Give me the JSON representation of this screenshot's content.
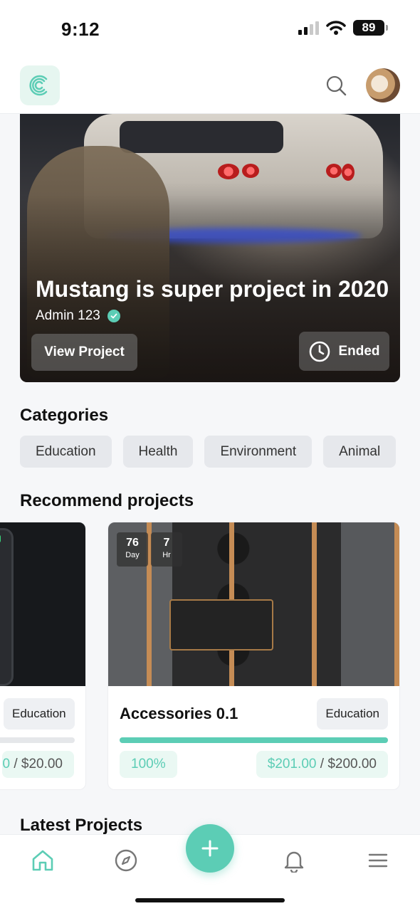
{
  "status_bar": {
    "time": "9:12",
    "battery": "89"
  },
  "header": {
    "logo": "C-logo-icon",
    "search": "search-icon"
  },
  "hero": {
    "title": "Mustang is super project in 2020",
    "author": "Admin 123",
    "view_button": "View Project",
    "status": "Ended"
  },
  "categories": {
    "title": "Categories",
    "items": [
      {
        "label": "Education"
      },
      {
        "label": "Health"
      },
      {
        "label": "Environment"
      },
      {
        "label": "Animal"
      }
    ]
  },
  "recommend": {
    "title": "Recommend projects",
    "cards": [
      {
        "tag": "Education",
        "raised": "0",
        "separator": "/",
        "goal": "$20.00",
        "progress": 0
      },
      {
        "name": "Accessories 0.1",
        "tag": "Education",
        "countdown": [
          {
            "num": "76",
            "unit": "Day"
          },
          {
            "num": "7",
            "unit": "Hr"
          }
        ],
        "percent": "100%",
        "raised": "$201.00",
        "separator": "/",
        "goal": "$200.00",
        "progress": 1.0
      }
    ]
  },
  "latest": {
    "title": "Latest Projects"
  },
  "colors": {
    "accent": "#5ccdb5",
    "chip_bg": "#e6e8ec",
    "pill_bg": "#eaf8f3"
  },
  "bottom_nav": {
    "items": [
      "home-icon",
      "compass-icon",
      "add-icon",
      "bell-icon",
      "menu-icon"
    ]
  }
}
